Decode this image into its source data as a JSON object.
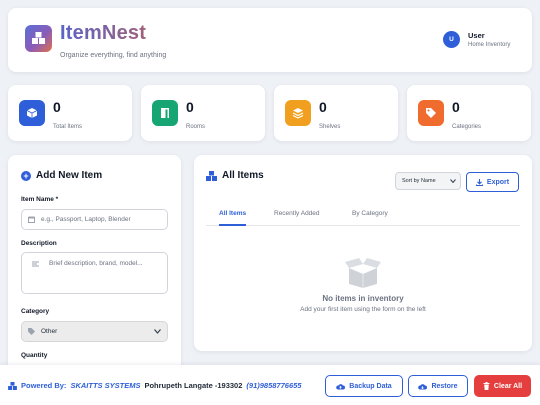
{
  "header": {
    "title": "ItemNest",
    "tagline": "Organize everything, find anything",
    "user": {
      "initial": "U",
      "name": "User",
      "subtitle": "Home Inventory"
    }
  },
  "stats": [
    {
      "value": "0",
      "label": "Total Items",
      "color": "#2f5fd8",
      "icon": "cube-icon"
    },
    {
      "value": "0",
      "label": "Rooms",
      "color": "#17a673",
      "icon": "door-icon"
    },
    {
      "value": "0",
      "label": "Shelves",
      "color": "#f0a01e",
      "icon": "layers-icon"
    },
    {
      "value": "0",
      "label": "Categories",
      "color": "#ef6c2e",
      "icon": "tags-icon"
    }
  ],
  "add_form": {
    "title": "Add New Item",
    "item_name": {
      "label": "Item Name *",
      "placeholder": "e.g., Passport, Laptop, Blender"
    },
    "description": {
      "label": "Description",
      "placeholder": "Brief description, brand, model..."
    },
    "category": {
      "label": "Category",
      "selected": "Other"
    },
    "quantity": {
      "label": "Quantity"
    }
  },
  "items": {
    "title": "All Items",
    "sort": {
      "selected": "Sort by Name"
    },
    "export_label": "Export",
    "tabs": [
      "All Items",
      "Recently Added",
      "By Category"
    ],
    "empty_title": "No items in inventory",
    "empty_subtitle": "Add your first item using the form on the left"
  },
  "footer": {
    "powered_prefix": "Powered By:",
    "company": "SKAITTS SYSTEMS",
    "address": "Pohrupeth Langate -193302",
    "phone": "(91)9858776655",
    "backup_label": "Backup Data",
    "restore_label": "Restore",
    "clear_label": "Clear All"
  },
  "colors": {
    "accent": "#2f5fd8",
    "danger": "#e53e3e",
    "background": "#eef1f6"
  }
}
